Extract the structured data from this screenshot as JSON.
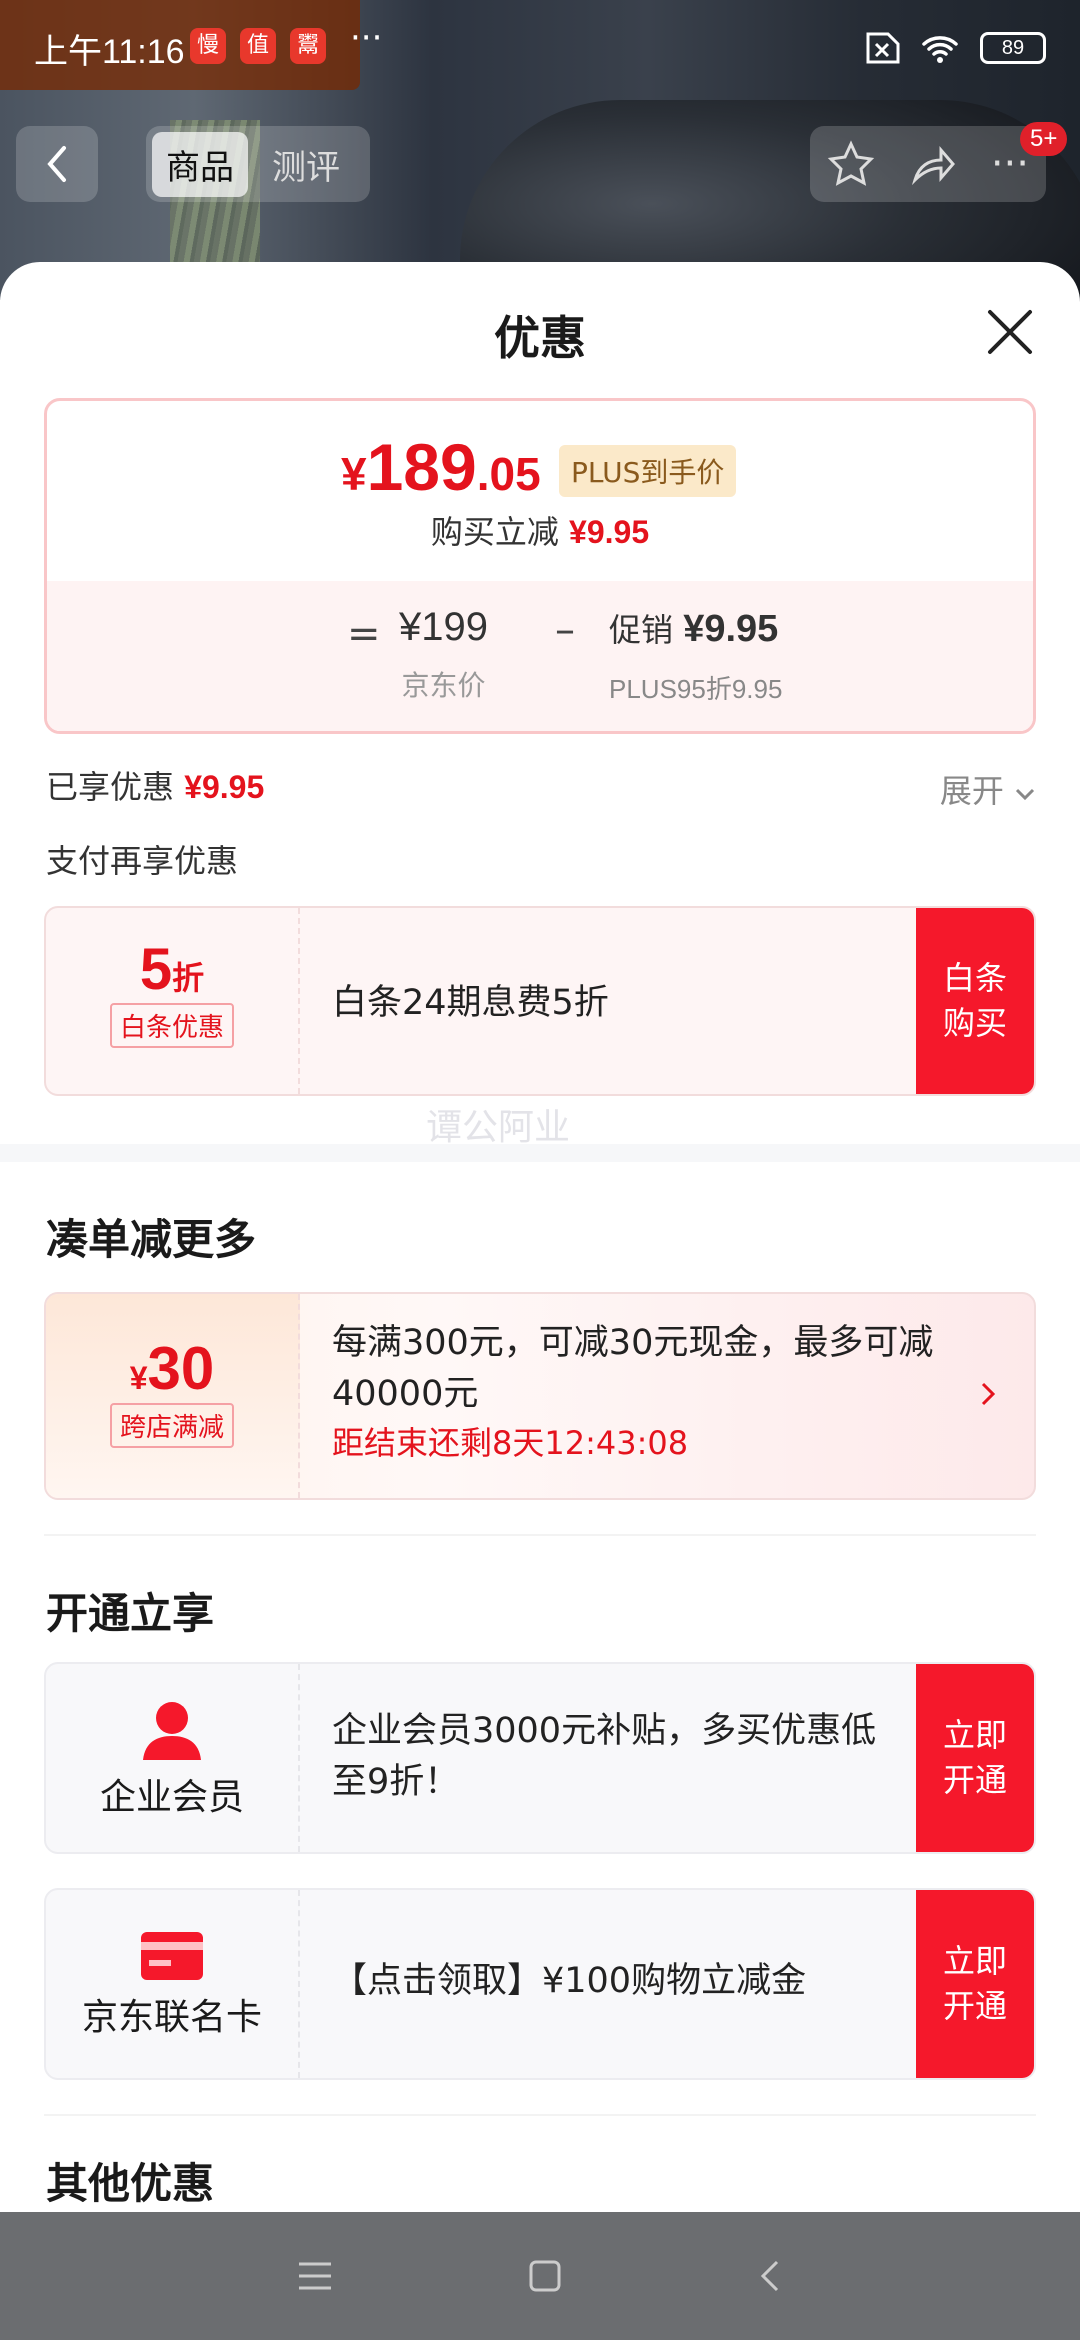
{
  "status_bar": {
    "time": "上午11:16",
    "apps": [
      "慢",
      "值",
      "鬻"
    ],
    "battery": "89"
  },
  "nav": {
    "tabs": [
      "商品",
      "测评"
    ],
    "badge": "5+"
  },
  "sheet": {
    "title": "优惠",
    "price": {
      "symbol": "¥",
      "integer": "189",
      "decimal": ".05",
      "plus_tag": "PLUS到手价",
      "reduce_label": "购买立减",
      "reduce_value": "¥9.95",
      "equals": "=",
      "jd_price": "¥199",
      "jd_label": "京东价",
      "minus": "–",
      "promo_label": "促销",
      "promo_value": "¥9.95",
      "promo_detail": "PLUS95折9.95"
    },
    "enjoyed_label": "已享优惠",
    "enjoyed_value": "¥9.95",
    "expand_label": "展开",
    "pay_more_label": "支付再享优惠",
    "baitiao": {
      "discount_num": "5",
      "discount_unit": "折",
      "tag": "白条优惠",
      "desc": "白条24期息费5折",
      "button": "白条\n购买"
    },
    "watermark": "谭公阿业",
    "section_more": "凑单减更多",
    "cross_store": {
      "symbol": "¥",
      "amount": "30",
      "tag": "跨店满减",
      "desc": "每满300元，可减30元现金，最多可减40000元",
      "countdown": "距结束还剩8天12:43:08"
    },
    "section_open": "开通立享",
    "enterprise": {
      "label": "企业会员",
      "desc": "企业会员3000元补贴，多买优惠低至9折！",
      "button": "立即\n开通"
    },
    "cobrand": {
      "label": "京东联名卡",
      "desc": "【点击领取】¥100购物立减金",
      "button": "立即\n开通"
    },
    "section_other": "其他优惠"
  },
  "colors": {
    "accent_red": "#e4131d",
    "button_red": "#f5182b",
    "plus_bg": "#fbe9c9"
  }
}
